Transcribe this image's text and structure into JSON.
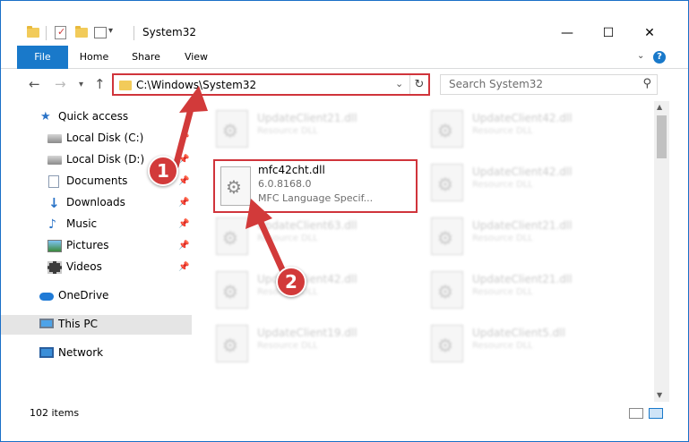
{
  "window": {
    "title": "System32",
    "minimize": "—",
    "maximize": "☐",
    "close": "✕"
  },
  "ribbon": {
    "file": "File",
    "home": "Home",
    "share": "Share",
    "view": "View"
  },
  "address": {
    "path": "C:\\Windows\\System32"
  },
  "search": {
    "placeholder": "Search System32"
  },
  "nav": {
    "items": [
      {
        "label": "Quick access"
      },
      {
        "label": "Local Disk (C:)"
      },
      {
        "label": "Local Disk (D:)"
      },
      {
        "label": "Documents"
      },
      {
        "label": "Downloads"
      },
      {
        "label": "Music"
      },
      {
        "label": "Pictures"
      },
      {
        "label": "Videos"
      },
      {
        "label": "OneDrive"
      },
      {
        "label": "This PC"
      },
      {
        "label": "Network"
      }
    ]
  },
  "files": {
    "left": [
      {
        "name": "UpdateClient21.dll",
        "desc": "Resource DLL"
      },
      {
        "name": "UpdateClient63.dll",
        "desc": "Resource DLL"
      },
      {
        "name": "UpdateClient42.dll",
        "desc": "Resource DLL"
      },
      {
        "name": "UpdateClient19.dll",
        "desc": "Resource DLL"
      }
    ],
    "right": [
      {
        "name": "UpdateClient42.dll",
        "desc": "Resource DLL"
      },
      {
        "name": "UpdateClient42.dll",
        "desc": "Resource DLL"
      },
      {
        "name": "UpdateClient21.dll",
        "desc": "Resource DLL"
      },
      {
        "name": "UpdateClient21.dll",
        "desc": "Resource DLL"
      },
      {
        "name": "UpdateClient5.dll",
        "desc": "Resource DLL"
      }
    ],
    "highlighted": {
      "name": "mfc42cht.dll",
      "version": "6.0.8168.0",
      "desc": "MFC Language Specif..."
    }
  },
  "status": {
    "count": "102 items"
  },
  "annotations": {
    "step1": "1",
    "step2": "2",
    "color": "#d23a3a"
  }
}
